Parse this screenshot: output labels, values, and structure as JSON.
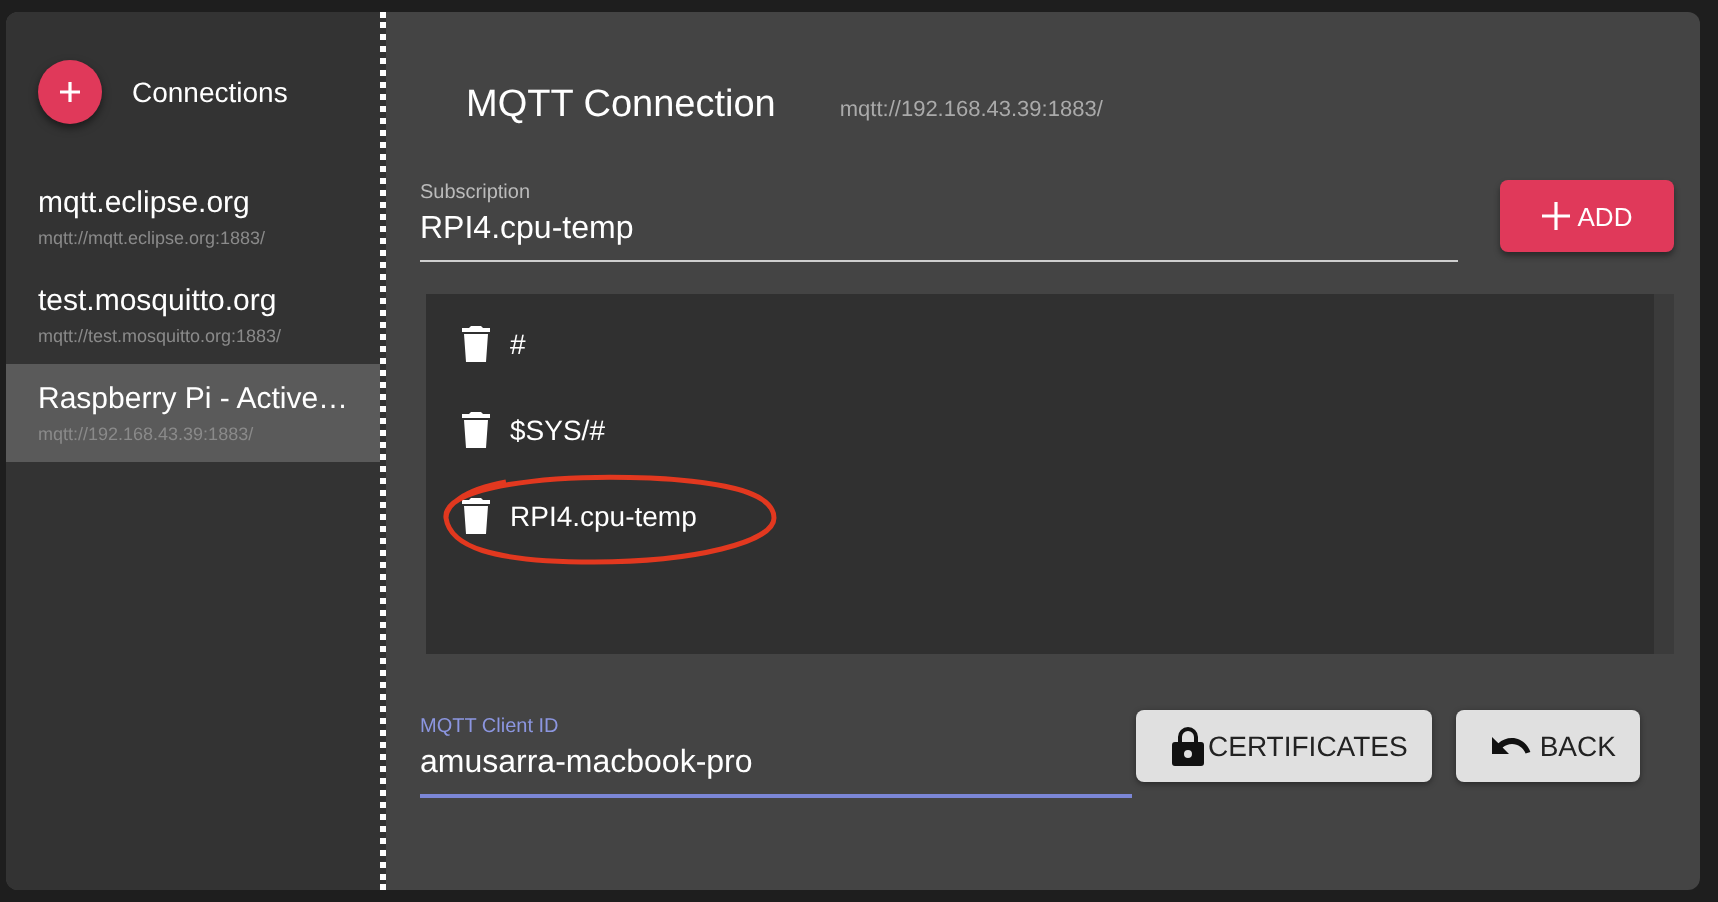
{
  "sidebar": {
    "title": "Connections",
    "items": [
      {
        "name": "mqtt.eclipse.org",
        "url": "mqtt://mqtt.eclipse.org:1883/",
        "selected": false
      },
      {
        "name": "test.mosquitto.org",
        "url": "mqtt://test.mosquitto.org:1883/",
        "selected": false
      },
      {
        "name": "Raspberry Pi - Active…",
        "url": "mqtt://192.168.43.39:1883/",
        "selected": true
      }
    ]
  },
  "main": {
    "title": "MQTT Connection",
    "url": "mqtt://192.168.43.39:1883/",
    "subscription": {
      "label": "Subscription",
      "value": "RPI4.cpu-temp"
    },
    "add_button": "ADD",
    "subscriptions": [
      {
        "topic": "#",
        "circled": false
      },
      {
        "topic": "$SYS/#",
        "circled": false
      },
      {
        "topic": "RPI4.cpu-temp",
        "circled": true
      }
    ],
    "client_id": {
      "label": "MQTT Client ID",
      "value": "amusarra-macbook-pro",
      "focused": true
    },
    "buttons": [
      {
        "kind": "certificates",
        "label": "CERTIFICATES"
      },
      {
        "kind": "back",
        "label": "BACK"
      }
    ]
  }
}
